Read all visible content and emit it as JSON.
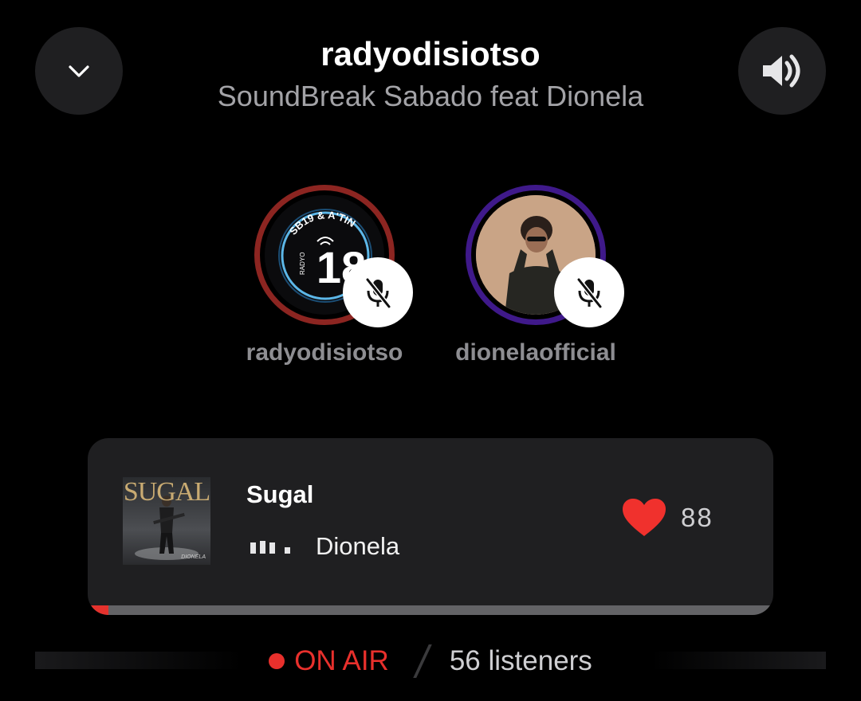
{
  "header": {
    "title": "radyodisiotso",
    "subtitle": "SoundBreak Sabado feat Dionela",
    "collapse_icon": "chevron-down-icon",
    "volume_icon": "speaker-volume-icon"
  },
  "hosts": [
    {
      "name": "radyodisiotso",
      "avatar_text": "SB19 & A'TIN",
      "ring_color": "#8c2521",
      "muted": true
    },
    {
      "name": "dionelaofficial",
      "ring_color": "#3f198a",
      "muted": true
    }
  ],
  "now_playing": {
    "album_title": "SUGAL",
    "album_artist": "DIONELA",
    "title": "Sugal",
    "artist": "Dionela",
    "likes": "88",
    "progress": 0.03
  },
  "status": {
    "on_air": "ON AIR",
    "listeners": "56 listeners"
  },
  "colors": {
    "background": "#000000",
    "card": "#1f1f21",
    "accent_red": "#e8302c",
    "text_muted": "#a3a3a7"
  }
}
